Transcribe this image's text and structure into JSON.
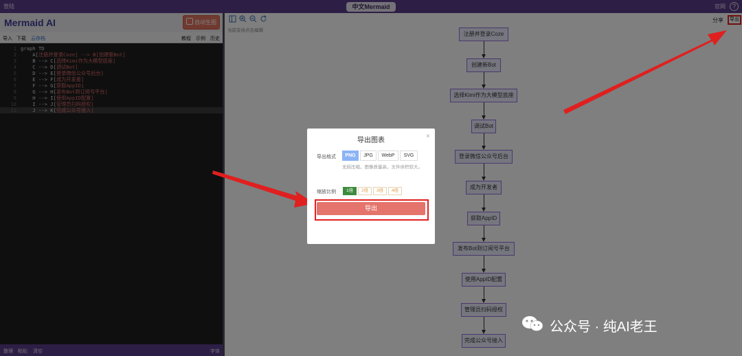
{
  "topbar": {
    "left_label": "登陆",
    "center_title": "中文Mermaid",
    "right_label": "官网",
    "help": "?"
  },
  "brand": {
    "title": "Mermaid AI",
    "auto_button": "自动生图"
  },
  "left_toolbar": {
    "import": "导入",
    "download": "下载",
    "cloud": "云存档",
    "tutorial": "教程",
    "examples": "示例",
    "history": "历史"
  },
  "code_lines": [
    {
      "n": "1",
      "pre": "graph TD",
      "b1": "",
      "mid": "",
      "b2": ""
    },
    {
      "n": "2",
      "pre": "    A[",
      "b1": "注册并登录Coze",
      "mid": "] --> B[",
      "b2": "创建新Bot]"
    },
    {
      "n": "3",
      "pre": "    B --> C[",
      "b1": "选择Kimi作为大模型底座",
      "mid": "]",
      "b2": ""
    },
    {
      "n": "4",
      "pre": "    C --> D[",
      "b1": "调试Bot",
      "mid": "]",
      "b2": ""
    },
    {
      "n": "5",
      "pre": "    D --> E[",
      "b1": "登录微信公众号后台",
      "mid": "]",
      "b2": ""
    },
    {
      "n": "6",
      "pre": "    E --> F[",
      "b1": "成为开发者",
      "mid": "]",
      "b2": ""
    },
    {
      "n": "7",
      "pre": "    F --> G[",
      "b1": "获取AppID",
      "mid": "]",
      "b2": ""
    },
    {
      "n": "8",
      "pre": "    G --> H[",
      "b1": "发布Bot到订阅号平台",
      "mid": "]",
      "b2": ""
    },
    {
      "n": "9",
      "pre": "    H --> I[",
      "b1": "使用AppID配置",
      "mid": "]",
      "b2": ""
    },
    {
      "n": "10",
      "pre": "    I --> J[",
      "b1": "管理员扫码授权",
      "mid": "]",
      "b2": ""
    },
    {
      "n": "11",
      "pre": "    J --> K[",
      "b1": "完成公众号接入",
      "mid": "]",
      "b2": ""
    }
  ],
  "left_footer": {
    "format": "整理",
    "paste": "粘贴",
    "clear": "清空",
    "font": "字体"
  },
  "right_toolbar": {
    "hint": "当前支持点击编辑",
    "share": "分享",
    "export": "导出"
  },
  "flow_nodes": [
    "注册并登录Coze",
    "创建新Bot",
    "选择Kimi作为大模型底座",
    "调试Bot",
    "登录微信公众号后台",
    "成为开发者",
    "获取AppID",
    "发布Bot到订阅号平台",
    "使用AppID配置",
    "管理员扫码授权",
    "完成公众号接入"
  ],
  "dialog": {
    "title": "导出图表",
    "close": "×",
    "format_label": "导出格式",
    "formats": [
      "PNG",
      "JPG",
      "WebP",
      "SVG"
    ],
    "selected_format": "PNG",
    "format_desc": "无损压缩，图像质量高，文件体积较大。",
    "scale_label": "缩放比例",
    "scales": [
      "1倍",
      "2倍",
      "3倍",
      "4倍"
    ],
    "selected_scale": "1倍",
    "export_button": "导出"
  },
  "watermark": {
    "text": "公众号 · 纯AI老王"
  },
  "colors": {
    "brand_purple": "#5a3d8a",
    "highlight_red": "#e01f1f",
    "export_button": "#e4746c",
    "node_fill": "#ececff",
    "node_border": "#9370db"
  }
}
